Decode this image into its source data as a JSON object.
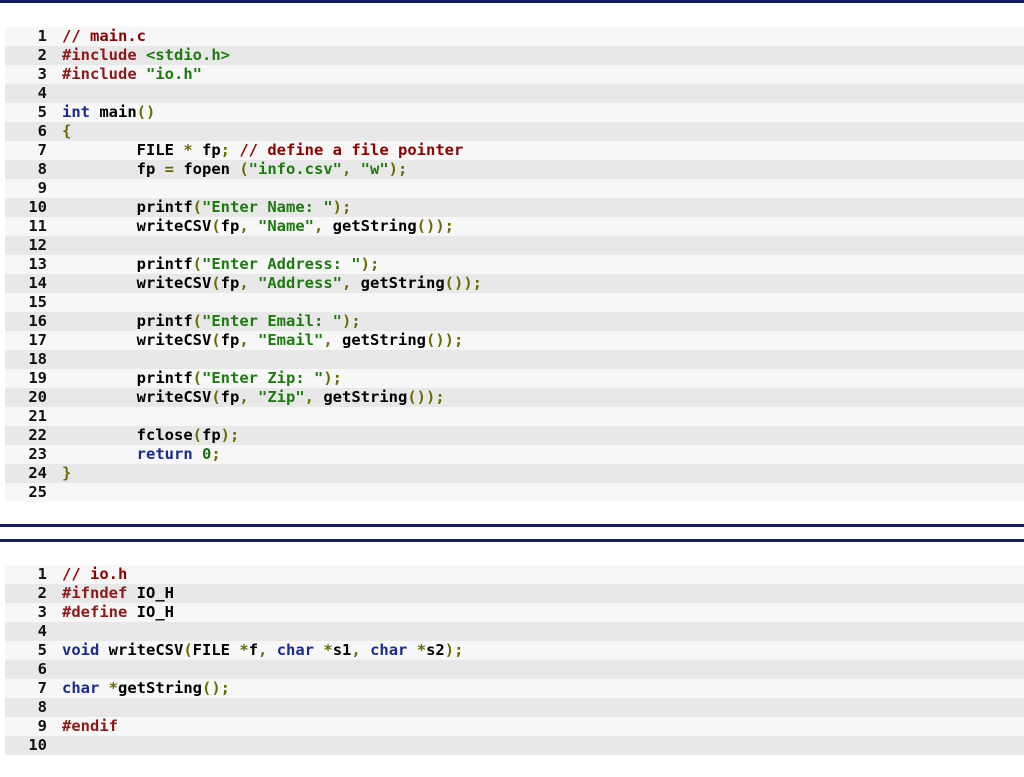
{
  "colors": {
    "rule": "#161d63",
    "row_odd": "#f7f7f7",
    "row_even": "#e8e8e8",
    "comment": "#8b0000",
    "preprocessor": "#8b1a1a",
    "string": "#1e7a10",
    "keyword": "#1a2b8c",
    "number": "#1e6a10",
    "punctuation": "#6a6a00"
  },
  "blocks": [
    {
      "lines": [
        {
          "n": "1",
          "tokens": [
            {
              "t": "// main.c",
              "k": "cmt"
            }
          ]
        },
        {
          "n": "2",
          "tokens": [
            {
              "t": "#include ",
              "k": "pre"
            },
            {
              "t": "<stdio.h>",
              "k": "str"
            }
          ]
        },
        {
          "n": "3",
          "tokens": [
            {
              "t": "#include ",
              "k": "pre"
            },
            {
              "t": "\"io.h\"",
              "k": "str"
            }
          ]
        },
        {
          "n": "4",
          "tokens": []
        },
        {
          "n": "5",
          "tokens": [
            {
              "t": "int",
              "k": "kw"
            },
            {
              "t": " main",
              "k": "plain"
            },
            {
              "t": "()",
              "k": "pun"
            }
          ]
        },
        {
          "n": "6",
          "tokens": [
            {
              "t": "{",
              "k": "pun"
            }
          ]
        },
        {
          "n": "7",
          "tokens": [
            {
              "t": "        FILE ",
              "k": "plain"
            },
            {
              "t": "*",
              "k": "pun"
            },
            {
              "t": " fp",
              "k": "plain"
            },
            {
              "t": ";",
              "k": "pun"
            },
            {
              "t": " // define a file pointer",
              "k": "cmt"
            }
          ]
        },
        {
          "n": "8",
          "tokens": [
            {
              "t": "        fp ",
              "k": "plain"
            },
            {
              "t": "=",
              "k": "pun"
            },
            {
              "t": " fopen ",
              "k": "plain"
            },
            {
              "t": "(",
              "k": "pun"
            },
            {
              "t": "\"info.csv\"",
              "k": "str"
            },
            {
              "t": ", ",
              "k": "pun"
            },
            {
              "t": "\"w\"",
              "k": "str"
            },
            {
              "t": ");",
              "k": "pun"
            }
          ]
        },
        {
          "n": "9",
          "tokens": []
        },
        {
          "n": "10",
          "tokens": [
            {
              "t": "        printf",
              "k": "plain"
            },
            {
              "t": "(",
              "k": "pun"
            },
            {
              "t": "\"Enter Name: \"",
              "k": "str"
            },
            {
              "t": ");",
              "k": "pun"
            }
          ]
        },
        {
          "n": "11",
          "tokens": [
            {
              "t": "        writeCSV",
              "k": "plain"
            },
            {
              "t": "(",
              "k": "pun"
            },
            {
              "t": "fp",
              "k": "plain"
            },
            {
              "t": ", ",
              "k": "pun"
            },
            {
              "t": "\"Name\"",
              "k": "str"
            },
            {
              "t": ", ",
              "k": "pun"
            },
            {
              "t": "getString",
              "k": "plain"
            },
            {
              "t": "());",
              "k": "pun"
            }
          ]
        },
        {
          "n": "12",
          "tokens": []
        },
        {
          "n": "13",
          "tokens": [
            {
              "t": "        printf",
              "k": "plain"
            },
            {
              "t": "(",
              "k": "pun"
            },
            {
              "t": "\"Enter Address: \"",
              "k": "str"
            },
            {
              "t": ");",
              "k": "pun"
            }
          ]
        },
        {
          "n": "14",
          "tokens": [
            {
              "t": "        writeCSV",
              "k": "plain"
            },
            {
              "t": "(",
              "k": "pun"
            },
            {
              "t": "fp",
              "k": "plain"
            },
            {
              "t": ", ",
              "k": "pun"
            },
            {
              "t": "\"Address\"",
              "k": "str"
            },
            {
              "t": ", ",
              "k": "pun"
            },
            {
              "t": "getString",
              "k": "plain"
            },
            {
              "t": "());",
              "k": "pun"
            }
          ]
        },
        {
          "n": "15",
          "tokens": []
        },
        {
          "n": "16",
          "tokens": [
            {
              "t": "        printf",
              "k": "plain"
            },
            {
              "t": "(",
              "k": "pun"
            },
            {
              "t": "\"Enter Email: \"",
              "k": "str"
            },
            {
              "t": ");",
              "k": "pun"
            }
          ]
        },
        {
          "n": "17",
          "tokens": [
            {
              "t": "        writeCSV",
              "k": "plain"
            },
            {
              "t": "(",
              "k": "pun"
            },
            {
              "t": "fp",
              "k": "plain"
            },
            {
              "t": ", ",
              "k": "pun"
            },
            {
              "t": "\"Email\"",
              "k": "str"
            },
            {
              "t": ", ",
              "k": "pun"
            },
            {
              "t": "getString",
              "k": "plain"
            },
            {
              "t": "());",
              "k": "pun"
            }
          ]
        },
        {
          "n": "18",
          "tokens": []
        },
        {
          "n": "19",
          "tokens": [
            {
              "t": "        printf",
              "k": "plain"
            },
            {
              "t": "(",
              "k": "pun"
            },
            {
              "t": "\"Enter Zip: \"",
              "k": "str"
            },
            {
              "t": ");",
              "k": "pun"
            }
          ]
        },
        {
          "n": "20",
          "tokens": [
            {
              "t": "        writeCSV",
              "k": "plain"
            },
            {
              "t": "(",
              "k": "pun"
            },
            {
              "t": "fp",
              "k": "plain"
            },
            {
              "t": ", ",
              "k": "pun"
            },
            {
              "t": "\"Zip\"",
              "k": "str"
            },
            {
              "t": ", ",
              "k": "pun"
            },
            {
              "t": "getString",
              "k": "plain"
            },
            {
              "t": "());",
              "k": "pun"
            }
          ]
        },
        {
          "n": "21",
          "tokens": []
        },
        {
          "n": "22",
          "tokens": [
            {
              "t": "        fclose",
              "k": "plain"
            },
            {
              "t": "(",
              "k": "pun"
            },
            {
              "t": "fp",
              "k": "plain"
            },
            {
              "t": ");",
              "k": "pun"
            }
          ]
        },
        {
          "n": "23",
          "tokens": [
            {
              "t": "        return ",
              "k": "kw"
            },
            {
              "t": "0",
              "k": "num"
            },
            {
              "t": ";",
              "k": "pun"
            }
          ]
        },
        {
          "n": "24",
          "tokens": [
            {
              "t": "}",
              "k": "pun"
            }
          ]
        },
        {
          "n": "25",
          "tokens": []
        }
      ]
    },
    {
      "lines": [
        {
          "n": "1",
          "tokens": [
            {
              "t": "// io.h",
              "k": "cmt"
            }
          ]
        },
        {
          "n": "2",
          "tokens": [
            {
              "t": "#ifndef ",
              "k": "pre"
            },
            {
              "t": "IO_H",
              "k": "plain"
            }
          ]
        },
        {
          "n": "3",
          "tokens": [
            {
              "t": "#define ",
              "k": "pre"
            },
            {
              "t": "IO_H",
              "k": "plain"
            }
          ]
        },
        {
          "n": "4",
          "tokens": []
        },
        {
          "n": "5",
          "tokens": [
            {
              "t": "void",
              "k": "kw"
            },
            {
              "t": " writeCSV",
              "k": "plain"
            },
            {
              "t": "(",
              "k": "pun"
            },
            {
              "t": "FILE ",
              "k": "plain"
            },
            {
              "t": "*",
              "k": "pun"
            },
            {
              "t": "f",
              "k": "plain"
            },
            {
              "t": ", ",
              "k": "pun"
            },
            {
              "t": "char ",
              "k": "kw"
            },
            {
              "t": "*",
              "k": "pun"
            },
            {
              "t": "s1",
              "k": "plain"
            },
            {
              "t": ", ",
              "k": "pun"
            },
            {
              "t": "char ",
              "k": "kw"
            },
            {
              "t": "*",
              "k": "pun"
            },
            {
              "t": "s2",
              "k": "plain"
            },
            {
              "t": ");",
              "k": "pun"
            }
          ]
        },
        {
          "n": "6",
          "tokens": []
        },
        {
          "n": "7",
          "tokens": [
            {
              "t": "char ",
              "k": "kw"
            },
            {
              "t": "*",
              "k": "pun"
            },
            {
              "t": "getString",
              "k": "plain"
            },
            {
              "t": "();",
              "k": "pun"
            }
          ]
        },
        {
          "n": "8",
          "tokens": []
        },
        {
          "n": "9",
          "tokens": [
            {
              "t": "#endif",
              "k": "pre"
            }
          ]
        },
        {
          "n": "10",
          "tokens": []
        }
      ]
    }
  ]
}
